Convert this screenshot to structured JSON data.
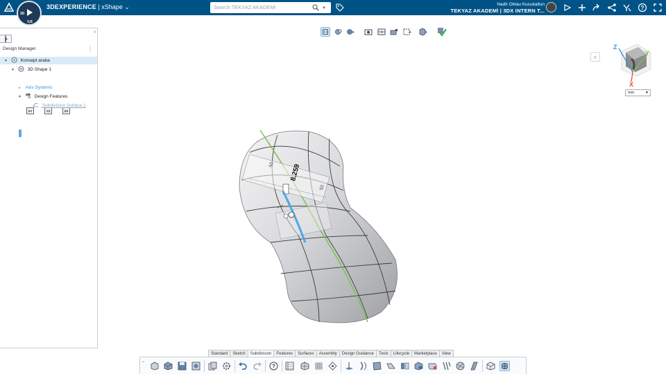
{
  "app": {
    "brand": "3DEXPERIENCE",
    "separator": "|",
    "app_name": "xShape",
    "compass_labels": [
      "3D",
      "V,R"
    ]
  },
  "search": {
    "placeholder": "Search TEKYAZ AKADEMİ"
  },
  "user": {
    "name": "Nadir Oktau Kucukaltun",
    "org": "TEKYAZ AKADEMİ | 3DX INTERN T..."
  },
  "top_icons": [
    "avatar",
    "share-3d-icon",
    "add-icon",
    "forward-icon",
    "share-icon",
    "apps-icon",
    "help-icon",
    "fullscreen-icon"
  ],
  "panel": {
    "title": "Design Manager",
    "tree": [
      {
        "label": "Konsept araba",
        "icon": "product-icon",
        "selected": true
      },
      {
        "label": "3D Shape 1",
        "icon": "shape-icon"
      },
      {
        "label": "Axis Systems",
        "icon": ""
      },
      {
        "label": "Design Features",
        "icon": "features-icon"
      },
      {
        "label": "Subdivision Surface.1",
        "icon": "subd-icon"
      }
    ],
    "planes": [
      "XY",
      "YZ",
      "ZX"
    ]
  },
  "viewport": {
    "dimension_value": "8.259",
    "ruler_labels": [
      "50",
      "50"
    ],
    "axes": {
      "x": "X",
      "y": "Y",
      "z": "Z"
    },
    "units": "mm"
  },
  "bottom_tabs": [
    "Standard",
    "Sketch",
    "Subdivision",
    "Features",
    "Surfaces",
    "Assembly",
    "Design Guidance",
    "Tools",
    "Lifecycle",
    "Marketplace",
    "View"
  ],
  "active_tab": "Subdivision",
  "colors": {
    "topbar": "#005386",
    "accent": "#5fa9d9",
    "active_bg": "#d6e8f6",
    "axis_x": "#e04848",
    "axis_y": "#7cc24a",
    "axis_z": "#3b8fd8"
  }
}
